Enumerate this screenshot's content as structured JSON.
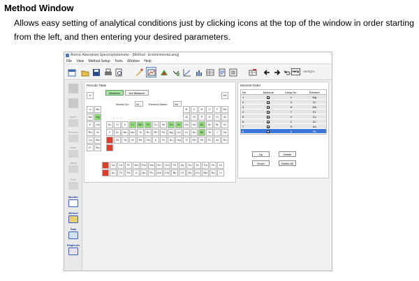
{
  "doc": {
    "heading": "Method Window",
    "description": "Allows easy setting of analytical conditions just by clicking icons at the top of the window in order starting from the left, and then entering your desired parameters."
  },
  "window": {
    "title": "Atomic Absorption Spectrophotometer - [Method : Environmental.amg]",
    "menu": [
      "File",
      "View",
      "Method Setup",
      "Tools",
      "Window",
      "Help"
    ],
    "help_label": "Help",
    "vivid_label": "VertiQ%"
  },
  "sidebar": {
    "items": [
      {
        "name": "",
        "active": false
      },
      {
        "name": "",
        "active": false
      },
      {
        "name": "Batch",
        "active": false
      },
      {
        "name": "Reclean",
        "active": false
      },
      {
        "name": "Wash",
        "active": false
      },
      {
        "name": "Adjust",
        "active": false
      },
      {
        "name": "Exec",
        "active": false
      },
      {
        "name": "Monitor",
        "active": true
      },
      {
        "name": "Method",
        "active": true
      },
      {
        "name": "Data",
        "active": true
      },
      {
        "name": "Diagnosis",
        "active": true
      }
    ]
  },
  "periodic": {
    "title": "Periodic Table",
    "measure_label": "Measure",
    "not_measure_label": "Not Measure",
    "atomic_no_label": "Atomic No.",
    "atomic_no_value": "51",
    "element_name_label": "Element Name",
    "element_name_value": "Sb",
    "rows": [
      [
        [
          "H",
          ""
        ],
        [
          "He",
          ""
        ]
      ],
      [
        [
          "Li",
          ""
        ],
        [
          "Be",
          ""
        ],
        [
          "B",
          ""
        ],
        [
          "C",
          ""
        ],
        [
          "N",
          ""
        ],
        [
          "O",
          ""
        ],
        [
          "F",
          ""
        ],
        [
          "Ne",
          ""
        ]
      ],
      [
        [
          "Na",
          ""
        ],
        [
          "Mg",
          "g"
        ],
        [
          "Al",
          ""
        ],
        [
          "Si",
          ""
        ],
        [
          "P",
          ""
        ],
        [
          "S",
          ""
        ],
        [
          "Cl",
          ""
        ],
        [
          "Ar",
          ""
        ]
      ],
      [
        [
          "K",
          ""
        ],
        [
          "Ca",
          ""
        ],
        [
          "Sc",
          ""
        ],
        [
          "Ti",
          ""
        ],
        [
          "V",
          ""
        ],
        [
          "Cr",
          "g"
        ],
        [
          "Mn",
          "g"
        ],
        [
          "Fe",
          "g"
        ],
        [
          "Co",
          ""
        ],
        [
          "Ni",
          ""
        ],
        [
          "Cu",
          "g"
        ],
        [
          "Zn",
          "g"
        ],
        [
          "Ga",
          ""
        ],
        [
          "Ge",
          ""
        ],
        [
          "As",
          "g"
        ],
        [
          "Se",
          ""
        ],
        [
          "Br",
          ""
        ],
        [
          "Kr",
          ""
        ]
      ],
      [
        [
          "Rb",
          ""
        ],
        [
          "Sr",
          ""
        ],
        [
          "Y",
          ""
        ],
        [
          "Zr",
          ""
        ],
        [
          "Nb",
          ""
        ],
        [
          "Mo",
          ""
        ],
        [
          "Tc",
          ""
        ],
        [
          "Ru",
          ""
        ],
        [
          "Rh",
          ""
        ],
        [
          "Pd",
          ""
        ],
        [
          "Ag",
          ""
        ],
        [
          "Cd",
          ""
        ],
        [
          "In",
          ""
        ],
        [
          "Sn",
          ""
        ],
        [
          "Sb",
          "g"
        ],
        [
          "Te",
          ""
        ],
        [
          "I",
          ""
        ],
        [
          "Xe",
          ""
        ]
      ],
      [
        [
          "Cs",
          ""
        ],
        [
          "Ba",
          ""
        ],
        [
          "",
          "r"
        ],
        [
          "Hf",
          ""
        ],
        [
          "Ta",
          ""
        ],
        [
          "W",
          ""
        ],
        [
          "Re",
          ""
        ],
        [
          "Os",
          ""
        ],
        [
          "Ir",
          ""
        ],
        [
          "Pt",
          ""
        ],
        [
          "Au",
          ""
        ],
        [
          "Hg",
          ""
        ],
        [
          "Tl",
          ""
        ],
        [
          "Pb",
          ""
        ],
        [
          "Bi",
          ""
        ],
        [
          "Po",
          ""
        ],
        [
          "At",
          ""
        ],
        [
          "Rn",
          ""
        ]
      ],
      [
        [
          "Fr",
          ""
        ],
        [
          "Ra",
          ""
        ],
        [
          "",
          "r"
        ]
      ]
    ],
    "lanthanides": [
      [
        "",
        "r"
      ],
      [
        "La",
        ""
      ],
      [
        "Ce",
        ""
      ],
      [
        "Pr",
        ""
      ],
      [
        "Nd",
        ""
      ],
      [
        "Pm",
        ""
      ],
      [
        "Sm",
        ""
      ],
      [
        "Eu",
        ""
      ],
      [
        "Gd",
        ""
      ],
      [
        "Tb",
        ""
      ],
      [
        "Dy",
        ""
      ],
      [
        "Ho",
        ""
      ],
      [
        "Er",
        ""
      ],
      [
        "Tm",
        ""
      ],
      [
        "Yb",
        ""
      ],
      [
        "Lu",
        ""
      ]
    ],
    "actinides": [
      [
        "",
        "r"
      ],
      [
        "Ac",
        ""
      ],
      [
        "Th",
        ""
      ],
      [
        "Pa",
        ""
      ],
      [
        "U",
        ""
      ],
      [
        "Np",
        ""
      ],
      [
        "Pu",
        ""
      ],
      [
        "Am",
        ""
      ],
      [
        "Cm",
        ""
      ],
      [
        "Bk",
        ""
      ],
      [
        "Cf",
        ""
      ],
      [
        "Es",
        ""
      ],
      [
        "Fm",
        ""
      ],
      [
        "Md",
        ""
      ],
      [
        "No",
        ""
      ],
      [
        "Lr",
        ""
      ]
    ]
  },
  "element_order": {
    "title": "Element Order",
    "headers": [
      "No.",
      "Measure",
      "Lamp No.",
      "Element"
    ],
    "rows": [
      {
        "no": "1",
        "lamp": "1",
        "element": "Mg",
        "selected": false
      },
      {
        "no": "2",
        "lamp": "3",
        "element": "Cr",
        "selected": false
      },
      {
        "no": "3",
        "lamp": "8",
        "element": "Mn",
        "selected": false
      },
      {
        "no": "4",
        "lamp": "7",
        "element": "Fe",
        "selected": false
      },
      {
        "no": "5",
        "lamp": "4",
        "element": "Cu",
        "selected": false
      },
      {
        "no": "6",
        "lamp": "2",
        "element": "Zn",
        "selected": false
      },
      {
        "no": "7",
        "lamp": "5",
        "element": "As",
        "selected": false
      },
      {
        "no": "8",
        "lamp": "6",
        "element": "Sb",
        "selected": true
      }
    ],
    "buttons": {
      "up": "Up",
      "delete": "Delete",
      "down": "Down",
      "delete_all": "Delete All"
    }
  }
}
